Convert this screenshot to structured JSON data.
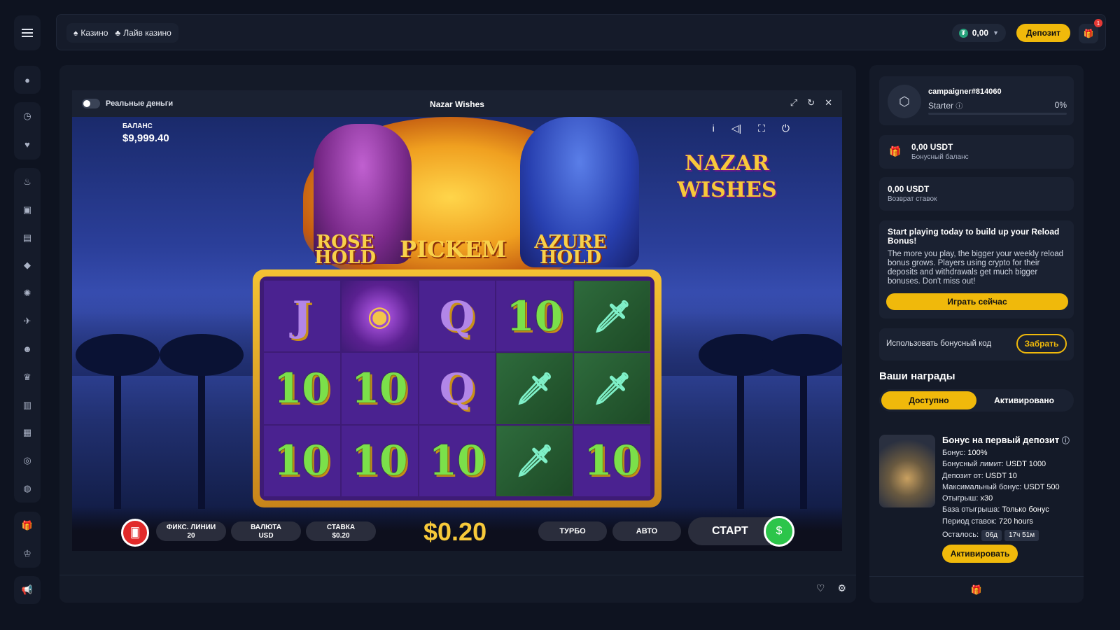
{
  "header": {
    "tabs": [
      {
        "icon": "casino-icon",
        "label": "Казино"
      },
      {
        "icon": "live-casino-icon",
        "label": "Лайв казино"
      }
    ],
    "balance": "0,00",
    "deposit_label": "Депозит",
    "notifications_count": "1"
  },
  "rail": {
    "groups": [
      [
        "user-icon"
      ],
      [
        "clock-icon",
        "heart-icon"
      ],
      [
        "fire-icon",
        "briefcase-icon",
        "slots-icon",
        "diamond-icon",
        "roulette-icon",
        "plane-icon",
        "dealer-icon",
        "crown-icon",
        "cards-icon",
        "cards-alt-icon",
        "chip-icon",
        "table-icon"
      ],
      [
        "gift-icon",
        "vip-crown-icon"
      ],
      [
        "megaphone-icon"
      ]
    ]
  },
  "game": {
    "real_money_label": "Реальные деньги",
    "title": "Nazar Wishes",
    "balance_label": "БАЛАНС",
    "balance_value": "$9,999.40",
    "logo": "NAZAR WISHES",
    "feature_titles": {
      "rose": "ROSE HOLD",
      "pickem": "PICKEM",
      "azure": "AZURE HOLD"
    },
    "reels": [
      [
        "J",
        "gem",
        "Q",
        "10",
        "dagger"
      ],
      [
        "10",
        "10",
        "Q",
        "dagger",
        "dagger"
      ],
      [
        "10",
        "10",
        "10",
        "dagger",
        "10"
      ]
    ],
    "controls": {
      "lines_label": "ФИКС. ЛИНИИ",
      "lines_value": "20",
      "currency_label": "ВАЛЮТА",
      "currency_value": "USD",
      "stake_label": "СТАВКА",
      "stake_value": "$0.20",
      "bet_display": "$0.20",
      "turbo_label": "ТУРБО",
      "auto_label": "АВТО",
      "start_label": "СТАРТ"
    }
  },
  "sidebar": {
    "username": "campaigner#814060",
    "tier": "Starter",
    "tier_progress": "0%",
    "bonus_balance": {
      "amount": "0,00 USDT",
      "label": "Бонусный баланс"
    },
    "cashback": {
      "amount": "0,00 USDT",
      "label": "Возврат ставок"
    },
    "promo": {
      "title": "Start playing today to build up your Reload Bonus!",
      "text": "The more you play, the bigger your weekly reload bonus grows. Players using crypto for their deposits and withdrawals get much bigger bonuses. Don't miss out!",
      "button": "Играть сейчас"
    },
    "promo_code": {
      "label": "Использовать бонусный код",
      "button": "Забрать"
    },
    "rewards_title": "Ваши награды",
    "reward_tabs": [
      "Доступно",
      "Активировано"
    ],
    "reward": {
      "title": "Бонус на первый депозит",
      "lines": [
        {
          "label": "Бонус:",
          "value": "100%"
        },
        {
          "label": "Бонусный лимит:",
          "value": "USDT 1000"
        },
        {
          "label": "Депозит от:",
          "value": "USDT 10"
        },
        {
          "label": "Максимальный бонус:",
          "value": "USDT 500"
        },
        {
          "label": "Отыгрыш:",
          "value": "x30"
        },
        {
          "label": "База отыгрыша:",
          "value": "Только бонус"
        },
        {
          "label": "Период ставок:",
          "value": "720 hours"
        }
      ],
      "remaining_label": "Осталось:",
      "remaining_days": "06д",
      "remaining_time": "17ч 51м",
      "button": "Активировать"
    }
  },
  "colors": {
    "accent": "#f0b90b",
    "bg": "#0e1320",
    "panel": "#141a28",
    "card": "#1a2131"
  }
}
